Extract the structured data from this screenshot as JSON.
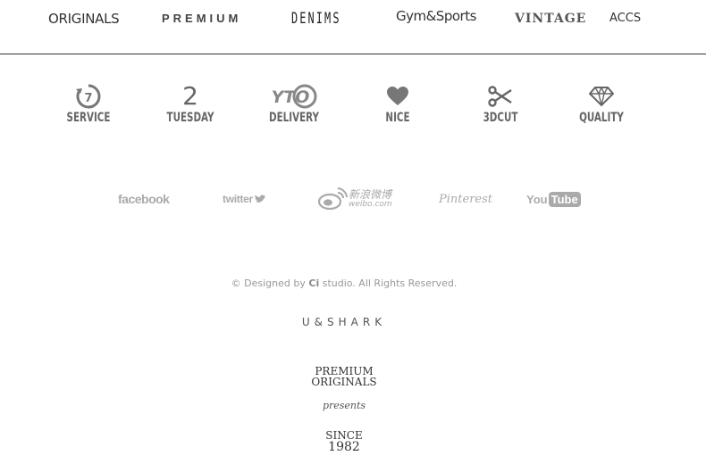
{
  "nav": {
    "items": [
      {
        "label": "ORIGINALS"
      },
      {
        "label": "PREMIUM"
      },
      {
        "label": "DENIMS"
      },
      {
        "label": "Gym&Sports"
      },
      {
        "label": "VINTAGE"
      },
      {
        "label": "ACCS"
      }
    ]
  },
  "features": [
    {
      "icon": "7-day-return-icon",
      "icon_text": "7",
      "label": "SERVICE"
    },
    {
      "icon": "number-two-icon",
      "icon_text": "2",
      "label": "TUESDAY"
    },
    {
      "icon": "yto-express-logo-icon",
      "icon_text": "YTO",
      "label": "DELIVERY"
    },
    {
      "icon": "heart-icon",
      "label": "NICE"
    },
    {
      "icon": "scissors-icon",
      "label": "3DCUT"
    },
    {
      "icon": "diamond-icon",
      "label": "QUALITY"
    }
  ],
  "social": {
    "facebook": "facebook",
    "twitter": "twitter",
    "weibo_cn": "新浪微博",
    "weibo_url": "weibo.com",
    "pinterest": "Pinterest",
    "youtube_you": "You",
    "youtube_tube": "Tube"
  },
  "footer": {
    "copyright_prefix": "© Designed by ",
    "copyright_brand": "Ci",
    "copyright_suffix": " studio. All Rights Reserved.",
    "brand": "U&SHARK",
    "line1": "PREMIUM",
    "line2": "ORIGINALS",
    "line3": "presents",
    "line4": "SINCE",
    "line5": "1982"
  },
  "colors": {
    "icon_gray": "#777777",
    "social_gray": "#aaaaaa",
    "divider": "#333333"
  }
}
